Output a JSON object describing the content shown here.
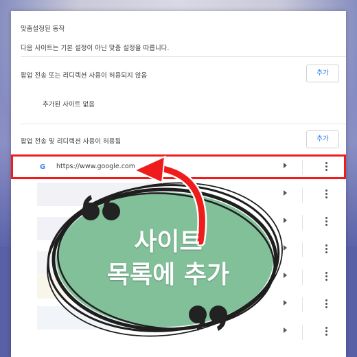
{
  "settings": {
    "section_title": "맞춤설정된 동작",
    "description": "다음 사이트는 기본 설정이 아닌 맞춤 설정을 따릅니다.",
    "blocked": {
      "label": "팝업 전송 또는 리디렉션 사용이 허용되지 않음",
      "add_label": "추가",
      "empty_text": "추가된 사이트 없음"
    },
    "allowed": {
      "label": "팝업 전송 및 리디렉션 사용이 허용됨",
      "add_label": "추가",
      "sites": [
        {
          "url": "https://www.google.com",
          "favicon": "google-g-icon"
        }
      ]
    }
  },
  "overlay": {
    "caption_line1": "사이트",
    "caption_line2": "목록에 추가",
    "colors": {
      "highlight_red": "#ef1c1c",
      "ellipse_green": "#82c09a",
      "quote_black": "#222222"
    }
  }
}
